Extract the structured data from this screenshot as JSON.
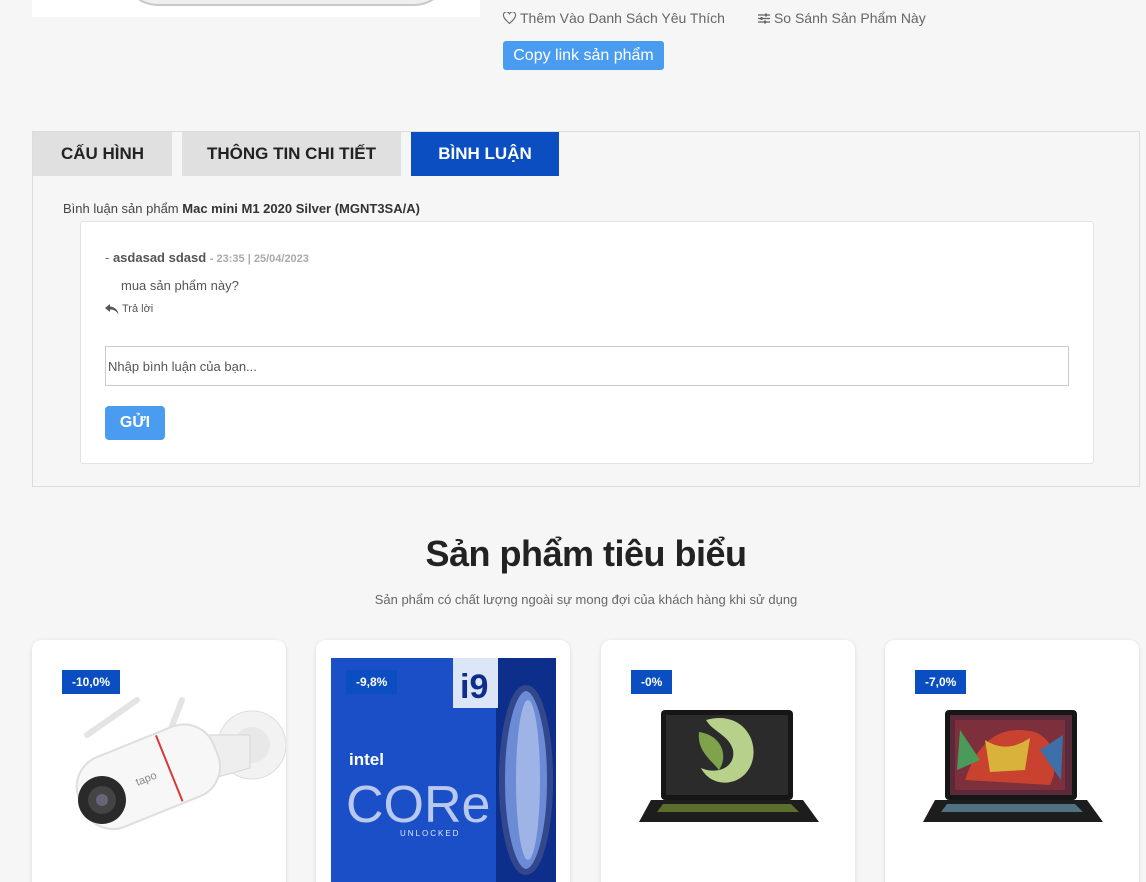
{
  "actions": {
    "wishlist": "Thêm Vào Danh Sách Yêu Thích",
    "compare": "So Sánh Sản Phẩm Này",
    "copy_link": "Copy link sản phẩm"
  },
  "tabs": [
    {
      "label": "CẤU HÌNH",
      "active": false
    },
    {
      "label": "THÔNG TIN CHI TIẾT",
      "active": false
    },
    {
      "label": "BÌNH LUẬN",
      "active": true
    }
  ],
  "comments": {
    "title_prefix": "Bình luận sản phẩm",
    "product_name": "Mac mini M1 2020 Silver (MGNT3SA/A)",
    "items": [
      {
        "author": "asdasad sdasd",
        "time": "23:35 | 25/04/2023",
        "text": "mua sản phẩm này?",
        "reply": "Trả lời"
      }
    ],
    "input_placeholder": "Nhập bình luận của bạn...",
    "send_label": "GỬI"
  },
  "featured": {
    "title": "Sản phẩm tiêu biểu",
    "subtitle": "Sản phẩm có chất lượng ngoài sự mong đợi của khách hàng khi sử dụng",
    "products": [
      {
        "discount": "-10,0%",
        "image": "security-camera-icon"
      },
      {
        "discount": "-9,8%",
        "image": "intel-core-i9-box-icon"
      },
      {
        "discount": "-0%",
        "image": "laptop-msi-icon"
      },
      {
        "discount": "-7,0%",
        "image": "laptop-gigabyte-icon"
      }
    ]
  },
  "colors": {
    "accent_blue": "#0a4ec2",
    "button_blue": "#4a9cf0"
  }
}
